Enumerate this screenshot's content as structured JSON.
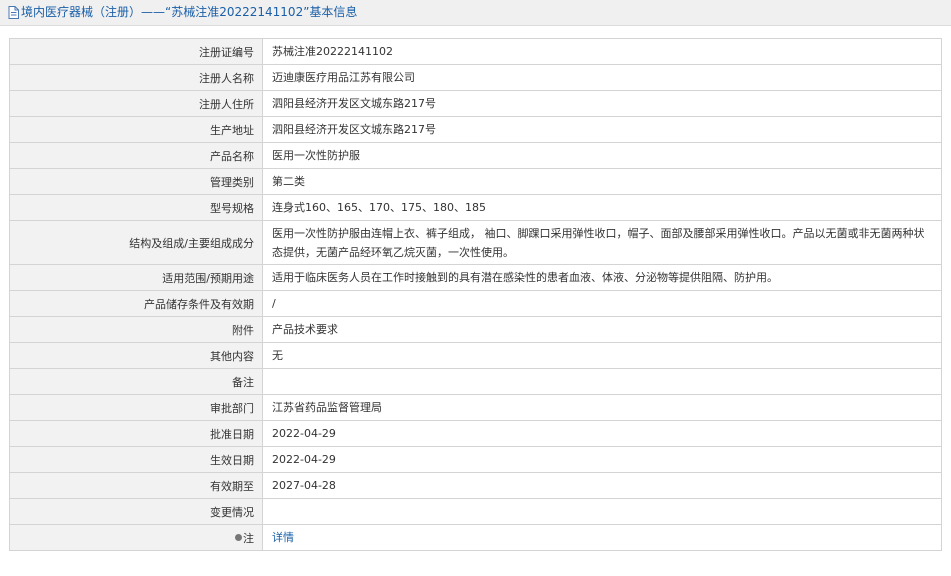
{
  "header": {
    "title": "境内医疗器械（注册）——“苏械注准20222141102”基本信息"
  },
  "rows": [
    {
      "label": "注册证编号",
      "value": "苏械注准20222141102"
    },
    {
      "label": "注册人名称",
      "value": "迈迪康医疗用品江苏有限公司"
    },
    {
      "label": "注册人住所",
      "value": "泗阳县经济开发区文城东路217号"
    },
    {
      "label": "生产地址",
      "value": "泗阳县经济开发区文城东路217号"
    },
    {
      "label": "产品名称",
      "value": "医用一次性防护服"
    },
    {
      "label": "管理类别",
      "value": "第二类"
    },
    {
      "label": "型号规格",
      "value": "连身式160、165、170、175、180、185"
    },
    {
      "label": "结构及组成/主要组成成分",
      "value": "医用一次性防护服由连帽上衣、裤子组成， 袖口、脚踝口采用弹性收口，帽子、面部及腰部采用弹性收口。产品以无菌或非无菌两种状态提供，无菌产品经环氧乙烷灭菌，一次性使用。"
    },
    {
      "label": "适用范围/预期用途",
      "value": "适用于临床医务人员在工作时接触到的具有潜在感染性的患者血液、体液、分泌物等提供阻隔、防护用。"
    },
    {
      "label": "产品储存条件及有效期",
      "value": "/"
    },
    {
      "label": "附件",
      "value": "产品技术要求"
    },
    {
      "label": "其他内容",
      "value": "无"
    },
    {
      "label": "备注",
      "value": ""
    },
    {
      "label": "审批部门",
      "value": "江苏省药品监督管理局"
    },
    {
      "label": "批准日期",
      "value": "2022-04-29"
    },
    {
      "label": "生效日期",
      "value": "2022-04-29"
    },
    {
      "label": "有效期至",
      "value": "2027-04-28"
    },
    {
      "label": "变更情况",
      "value": ""
    }
  ],
  "note_row": {
    "label": "注",
    "link_text": "详情"
  },
  "icons": {
    "title_icon": "document-icon",
    "note_icon": "bullet-icon"
  },
  "colors": {
    "title_text": "#1a5fa8",
    "link": "#1a5fa8",
    "label_bg": "#f2f2f2",
    "border": "#d4d4d4"
  }
}
